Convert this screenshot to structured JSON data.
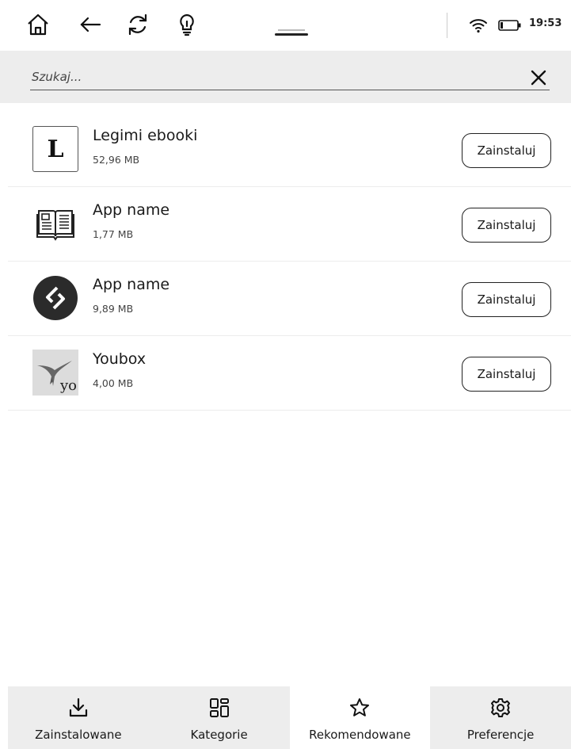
{
  "status_bar": {
    "icons": [
      "home-icon",
      "back-arrow-icon",
      "refresh-icon",
      "lightbulb-icon"
    ],
    "time": "19:53"
  },
  "search": {
    "placeholder": "Szukaj...",
    "value": ""
  },
  "apps": [
    {
      "name": "Legimi ebooki",
      "size": "52,96 MB",
      "icon": "legimi-logo-icon",
      "button": "Zainstaluj"
    },
    {
      "name": "App name",
      "size": "1,77 MB",
      "icon": "open-book-icon",
      "button": "Zainstaluj"
    },
    {
      "name": "App name",
      "size": "9,89 MB",
      "icon": "diamond-logo-icon",
      "button": "Zainstaluj"
    },
    {
      "name": "Youbox",
      "size": "4,00 MB",
      "icon": "youbox-logo-icon",
      "button": "Zainstaluj",
      "icon_text": "yo"
    }
  ],
  "legimi_icon_letter": "L",
  "bottom_nav": [
    {
      "label": "Zainstalowane",
      "icon": "download-icon",
      "active": false
    },
    {
      "label": "Kategorie",
      "icon": "categories-icon",
      "active": false
    },
    {
      "label": "Rekomendowane",
      "icon": "star-icon",
      "active": true
    },
    {
      "label": "Preferencje",
      "icon": "gear-icon",
      "active": false
    }
  ]
}
